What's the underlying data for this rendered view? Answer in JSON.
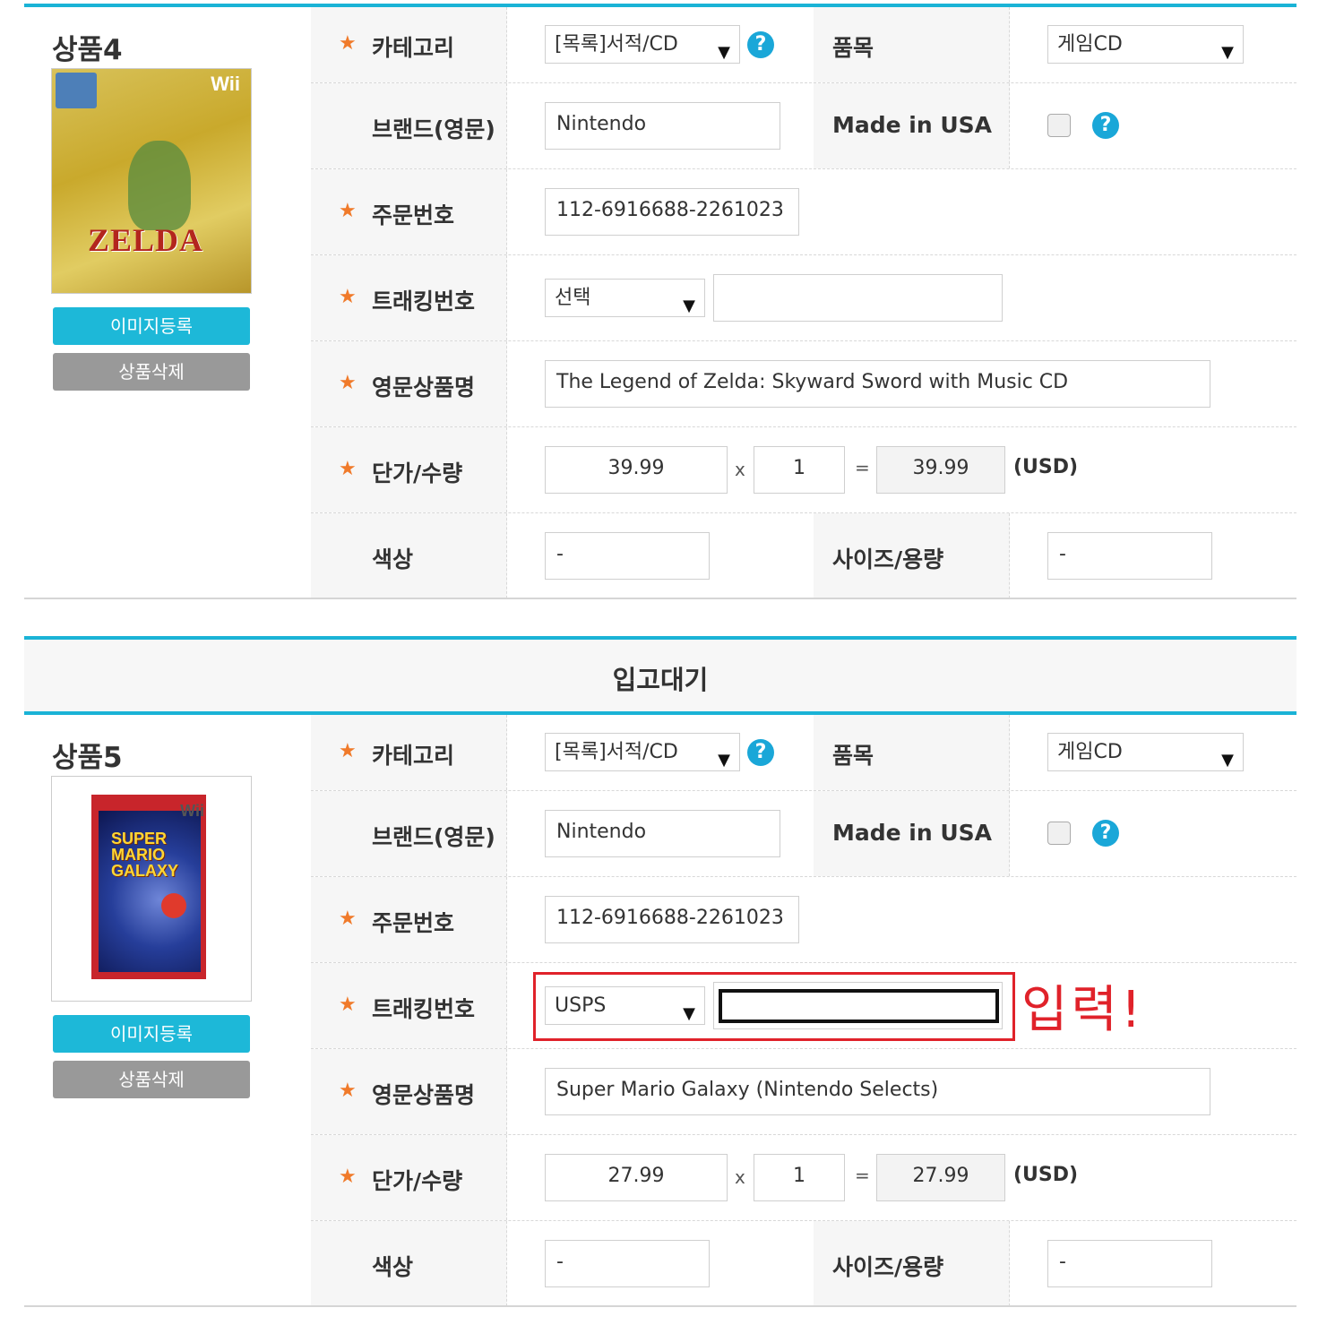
{
  "section": {
    "title": "입고대기"
  },
  "labels": {
    "category": "카테고리",
    "item": "품목",
    "brand": "브랜드(영문)",
    "made_in_usa": "Made in USA",
    "order_no": "주문번호",
    "tracking": "트래킹번호",
    "name_en": "영문상품명",
    "price_qty": "단가/수량",
    "color": "색상",
    "size": "사이즈/용량",
    "currency": "(USD)",
    "times": "x",
    "equals": "=",
    "star": "★",
    "help": "?",
    "arrow": "▼"
  },
  "buttons": {
    "upload_image": "이미지등록",
    "delete_product": "상품삭제"
  },
  "products": [
    {
      "title": "상품4",
      "image": {
        "platform": "Wii",
        "logo": "ZELDA"
      },
      "category": "[목록]서적/CD",
      "item": "게임CD",
      "brand": "Nintendo",
      "made_in_usa": false,
      "order_no": "112-6916688-2261023",
      "tracking_carrier": "선택",
      "tracking_no": "",
      "name_en": "The Legend of Zelda: Skyward Sword with Music CD",
      "price": "39.99",
      "qty": "1",
      "total": "39.99",
      "color": "-",
      "size": "-"
    },
    {
      "title": "상품5",
      "image": {
        "platform": "Wii",
        "logo": "SUPER MARIO GALAXY"
      },
      "category": "[목록]서적/CD",
      "item": "게임CD",
      "brand": "Nintendo",
      "made_in_usa": false,
      "order_no": "112-6916688-2261023",
      "tracking_carrier": "USPS",
      "tracking_no": "",
      "name_en": "Super Mario Galaxy (Nintendo Selects)",
      "price": "27.99",
      "qty": "1",
      "total": "27.99",
      "color": "-",
      "size": "-"
    }
  ],
  "annotation": {
    "text": "입력!",
    "color": "#e0222a"
  },
  "colors": {
    "accent": "#1ab3d6",
    "star": "#f07a2a",
    "help": "#1aa7d8",
    "delete_button": "#999999"
  }
}
